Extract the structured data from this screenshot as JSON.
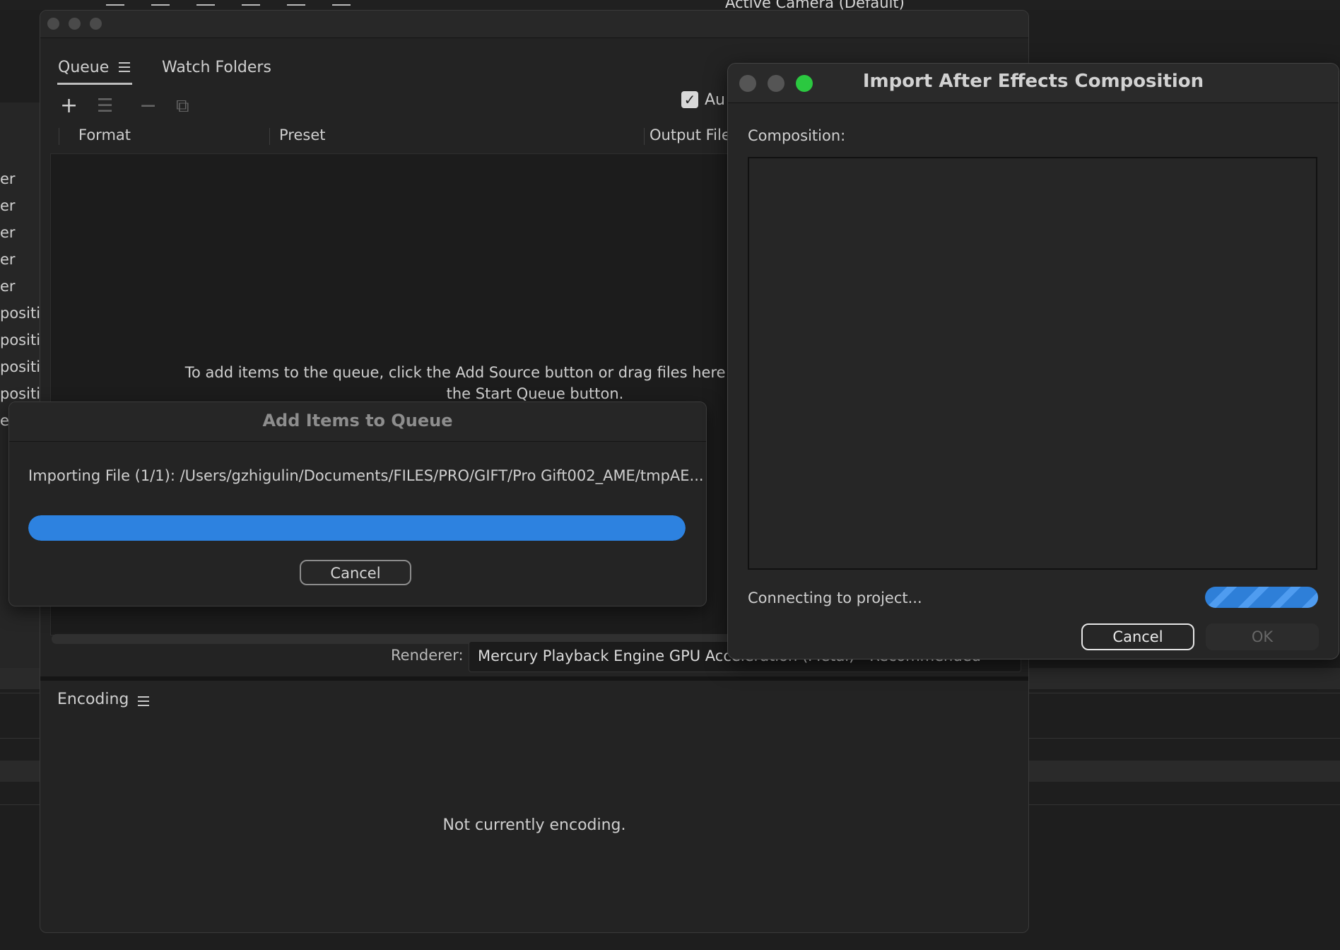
{
  "background_app": {
    "camera_label": "Active Camera (Default)",
    "left_rows": [
      "er",
      "er",
      "er",
      "er",
      "er",
      "positi",
      "positi",
      "positi",
      "positi",
      "e"
    ]
  },
  "queue_panel": {
    "tabs": [
      {
        "label": "Queue",
        "active": true
      },
      {
        "label": "Watch Folders",
        "active": false
      }
    ],
    "toolbar_icons": [
      "add-source-icon",
      "add-output-icon",
      "remove-icon",
      "duplicate-icon"
    ],
    "auto_encode_label": "Au",
    "auto_encode_checked": true,
    "columns": [
      "Format",
      "Preset",
      "Output File"
    ],
    "hint_line1": "To add items to the queue, click the Add Source button or drag files here from the Media Brow",
    "hint_line2": "the Start Queue button."
  },
  "renderer": {
    "label": "Renderer:",
    "value": "Mercury Playback Engine GPU Acceleration (Metal) - Recommended"
  },
  "encoding_panel": {
    "tab_label": "Encoding",
    "status": "Not currently encoding."
  },
  "add_items_dialog": {
    "title": "Add Items to Queue",
    "importing_text": "Importing File (1/1): /Users/gzhigulin/Documents/FILES/PRO/GIFT/Pro Gift002_AME/tmpAE...",
    "progress_fraction": 1.0,
    "cancel_label": "Cancel",
    "progress_color": "#2d82e0"
  },
  "ae_import_dialog": {
    "title": "Import After Effects Composition",
    "composition_label": "Composition:",
    "status": "Connecting to project...",
    "progress_state": "indeterminate",
    "cancel_label": "Cancel",
    "ok_label": "OK",
    "ok_enabled": false,
    "traffic_lights": [
      "#555555",
      "#555555",
      "#2bc840"
    ]
  }
}
